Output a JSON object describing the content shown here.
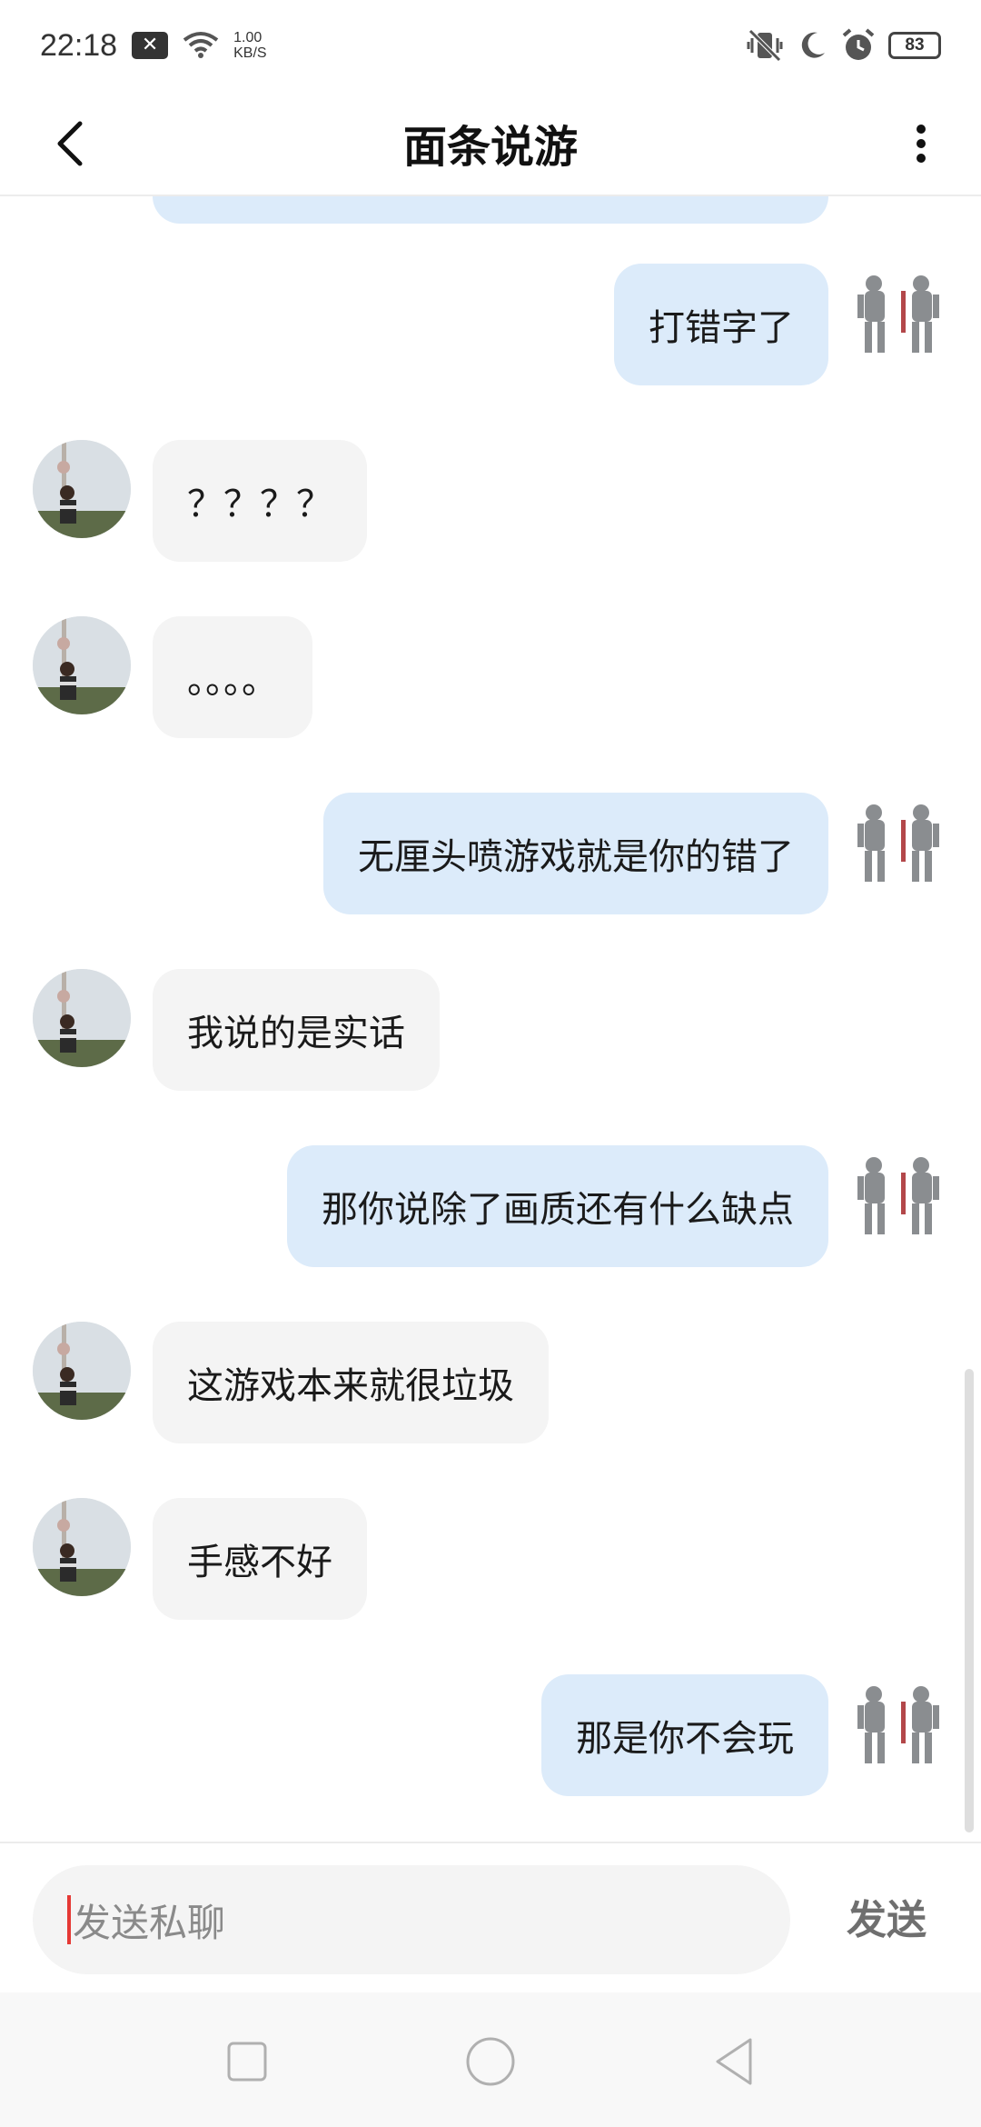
{
  "status_bar": {
    "time": "22:18",
    "speed_value": "1.00",
    "speed_unit": "KB/S",
    "battery": "83",
    "icons": [
      "notification-x-icon",
      "wifi-icon",
      "vibrate-off-icon",
      "moon-icon",
      "alarm-icon",
      "battery-icon"
    ]
  },
  "header": {
    "title": "面条说游",
    "back_icon": "back-chevron-icon",
    "more_icon": "more-vertical-icon"
  },
  "messages": [
    {
      "side": "right",
      "text": "打错字了"
    },
    {
      "side": "left",
      "text": "？？？？"
    },
    {
      "side": "left",
      "text": "。。。。"
    },
    {
      "side": "right",
      "text": "无厘头喷游戏就是你的错了"
    },
    {
      "side": "left",
      "text": "我说的是实话"
    },
    {
      "side": "right",
      "text": "那你说除了画质还有什么缺点"
    },
    {
      "side": "left",
      "text": "这游戏本来就很垃圾"
    },
    {
      "side": "left",
      "text": "手感不好"
    },
    {
      "side": "right",
      "text": "那是你不会玩"
    }
  ],
  "composer": {
    "placeholder": "发送私聊",
    "send_label": "发送"
  },
  "nav": {
    "icons": [
      "recents-square-icon",
      "home-circle-icon",
      "back-triangle-icon"
    ]
  },
  "colors": {
    "my_bubble": "#dcebfa",
    "their_bubble": "#f4f4f4",
    "cursor": "#e53935"
  }
}
